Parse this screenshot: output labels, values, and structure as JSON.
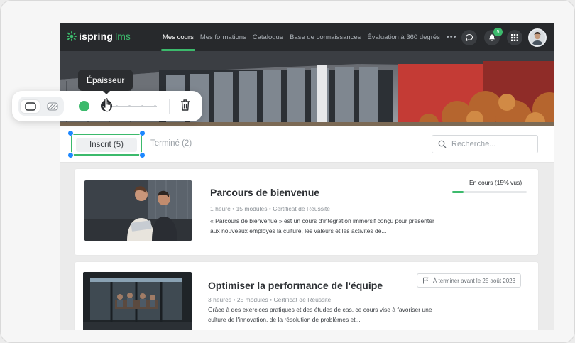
{
  "app": {
    "logo_name": "ispring",
    "logo_suffix": "lms",
    "nav": [
      "Mes cours",
      "Mes formations",
      "Catalogue",
      "Base de connaissances",
      "Évaluation à 360 degrés"
    ],
    "nav_more": "•••",
    "notifications_count": "5"
  },
  "tabs": {
    "enrolled": "Inscrit (5)",
    "completed": "Terminé (2)"
  },
  "search": {
    "placeholder": "Recherche..."
  },
  "courses": [
    {
      "title": "Parcours de bienvenue",
      "meta": [
        "1 heure",
        "15 modules",
        "Certificat de Réussite"
      ],
      "description": "« Parcours de bienvenue » est un cours d'intégration immersif conçu pour présenter aux nouveaux employés la culture, les valeurs et les activités de...",
      "status": "En cours (15% vus)",
      "progress": 0.15
    },
    {
      "title": "Optimiser la performance de l'équipe",
      "meta": [
        "3 heures",
        "25 modules",
        "Certificat de Réussite"
      ],
      "description": "Grâce à des exercices pratiques et des études de cas, ce cours vise à favoriser une culture de l'innovation, de la résolution de problèmes et...",
      "due": "À terminer avant le 25 août 2023"
    }
  ],
  "toolbar": {
    "tooltip": "Épaisseur",
    "selected_color": "#3cba6c"
  },
  "colors": {
    "accent": "#3cba6c",
    "topbar": "#27292c",
    "selection": "#1e88ff"
  }
}
